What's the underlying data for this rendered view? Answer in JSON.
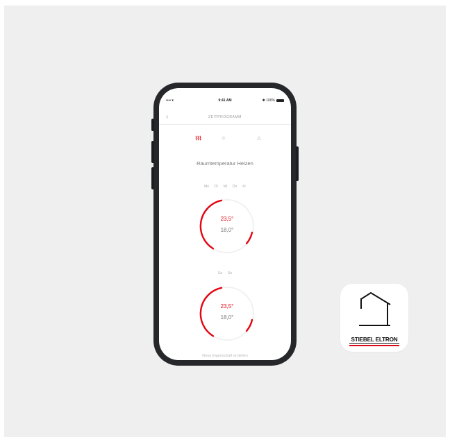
{
  "status_bar": {
    "signal": "•••• ▾",
    "time": "9:41 AM",
    "battery": "✱ 100%"
  },
  "nav": {
    "back_glyph": "‹",
    "title": "ZEITPROGRAMM"
  },
  "modes": [
    {
      "name": "heating-mode",
      "glyph": "⌇⌇⌇",
      "active": true
    },
    {
      "name": "cooling-mode",
      "glyph": "❄",
      "active": false
    },
    {
      "name": "hot-water-mode",
      "glyph": "∆",
      "active": false
    }
  ],
  "section_title": "Raumtemperatur Heizen",
  "weekdays": [
    "Mo",
    "Di",
    "Mi",
    "Do",
    "Fr"
  ],
  "weekend": [
    "Sa",
    "So"
  ],
  "schedules": [
    {
      "comfort_temp": "23,5°",
      "eco_temp": "18,0°"
    },
    {
      "comfort_temp": "23,5°",
      "eco_temp": "18,0°"
    }
  ],
  "footer_text": "Neue Eigenschaft erstellen",
  "app_icon": {
    "brand": "STIEBEL ELTRON"
  },
  "colors": {
    "accent": "#e30613",
    "background": "#efefef",
    "phone_frame": "#26272b"
  }
}
